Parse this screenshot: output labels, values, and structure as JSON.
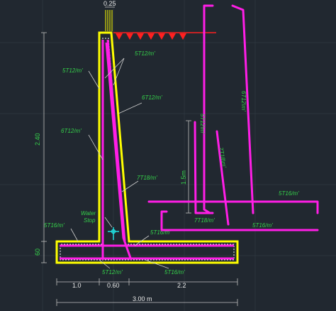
{
  "colors": {
    "background": "#212830",
    "concrete_outline": "#ffff00",
    "rebar": "#ff1ee6",
    "labels": "#35d04a",
    "dimension_text": "#e8e8e8",
    "soil_hatch": "#ff2020",
    "water_stop": "#20e0e0",
    "leader_lines": "#cfcfcf"
  },
  "dimensions": {
    "top_width": "0.25",
    "wall_height": "2.40",
    "base_thickness": "60",
    "toe_width": "1.0",
    "stem_base_width": "0.60",
    "heel_width": "2.2",
    "total_width": "3.00  m",
    "detail_height": "1.5m"
  },
  "labels": {
    "stem_front_upper": "5T12/m'",
    "stem_front_mid": "6T12/m'",
    "stem_back_upper": "5T12/m'",
    "stem_back_mid": "6T12/m'",
    "stem_back_lower": "7T18/m'",
    "toe_top": "5T16/m'",
    "heel_top": "5T16/m'",
    "base_bottom_left": "5T12/m'",
    "base_bottom_right": "5T16/m'",
    "water_stop": "Water\nStop",
    "water_stop_line1": "Water",
    "water_stop_line2": "Stop",
    "detail_vertical_left": "5T12\\m'",
    "detail_vertical_right": "6T12\\m'",
    "detail_vertical_mid": "7T18\\m'",
    "detail_bar_center": "7T18/m'",
    "detail_bar_top_right": "5T16/m'",
    "detail_bar_bottom_right": "5T16/m'"
  }
}
